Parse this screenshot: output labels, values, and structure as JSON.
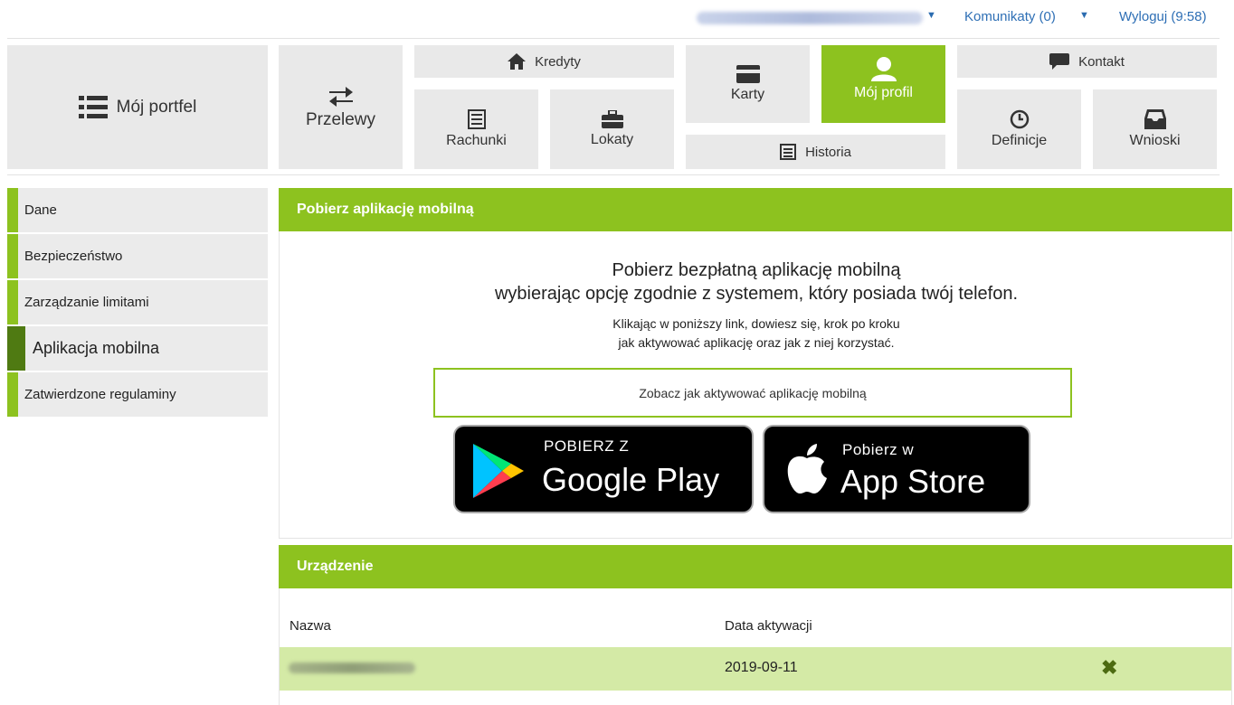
{
  "topbar": {
    "messages_label": "Komunikaty (0)",
    "logout_label": "Wyloguj (9:58)"
  },
  "nav": {
    "portfolio": "Mój portfel",
    "transfers": "Przelewy",
    "credits": "Kredyty",
    "accounts": "Rachunki",
    "deposits": "Lokaty",
    "cards": "Karty",
    "my_profile": "Mój profil",
    "history": "Historia",
    "contact": "Kontakt",
    "definitions": "Definicje",
    "applications": "Wnioski"
  },
  "sidebar": {
    "items": [
      {
        "label": "Dane"
      },
      {
        "label": "Bezpieczeństwo"
      },
      {
        "label": "Zarządzanie limitami"
      },
      {
        "label": "Aplikacja mobilna"
      },
      {
        "label": "Zatwierdzone regulaminy"
      }
    ]
  },
  "mobile_app": {
    "header": "Pobierz aplikację mobilną",
    "title_line1": "Pobierz bezpłatną aplikację mobilną",
    "title_line2": "wybierając opcję zgodnie z systemem, który posiada twój telefon.",
    "sub_line1": "Klikając w poniższy link, dowiesz się, krok po kroku",
    "sub_line2": "jak aktywować aplikację oraz jak z niej korzystać.",
    "how_button": "Zobacz jak aktywować aplikację mobilną",
    "google_small": "POBIERZ Z",
    "google_big": "Google Play",
    "apple_small": "Pobierz w",
    "apple_big": "App Store"
  },
  "device": {
    "header": "Urządzenie",
    "col_name": "Nazwa",
    "col_date": "Data aktywacji",
    "rows": [
      {
        "date": "2019-09-11"
      }
    ]
  },
  "colors": {
    "accent": "#8dc21f",
    "active_sidebar": "#4f7a12",
    "row_highlight": "#d4eaa6",
    "link": "#2e6fb5"
  }
}
